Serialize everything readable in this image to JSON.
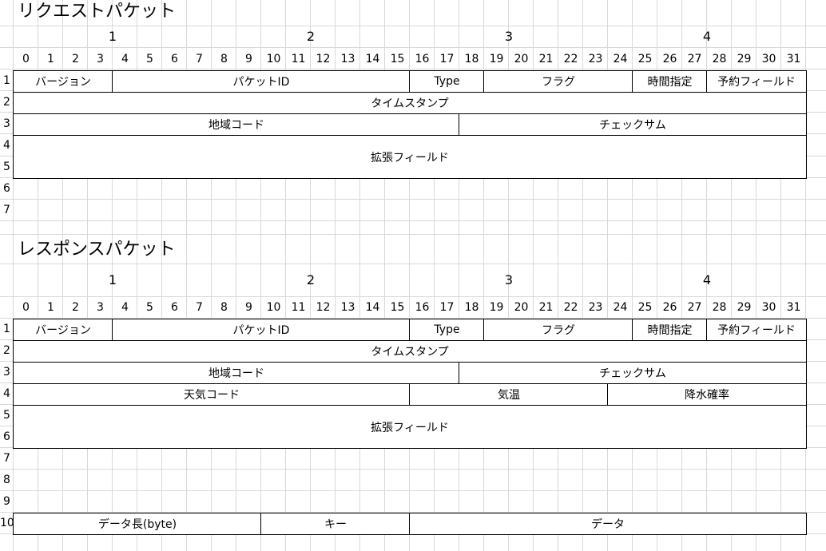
{
  "sheet": {
    "grid_line_color": "#d9d9d9",
    "border_color": "#000000"
  },
  "sections": [
    {
      "id": "request",
      "title": "リクエストパケット",
      "byte_labels": [
        "1",
        "2",
        "3",
        "4"
      ],
      "bit_labels": [
        "0",
        "1",
        "2",
        "3",
        "4",
        "5",
        "6",
        "7",
        "8",
        "9",
        "10",
        "11",
        "12",
        "13",
        "14",
        "15",
        "16",
        "17",
        "18",
        "19",
        "20",
        "21",
        "22",
        "23",
        "24",
        "25",
        "26",
        "27",
        "28",
        "29",
        "30",
        "31"
      ],
      "row_labels": [
        "1",
        "2",
        "3",
        "4",
        "5",
        "6",
        "7"
      ],
      "fields": [
        {
          "label": "バージョン",
          "row": 1,
          "rows": 1,
          "bit_start": 0,
          "bit_end": 3
        },
        {
          "label": "パケットID",
          "row": 1,
          "rows": 1,
          "bit_start": 4,
          "bit_end": 15
        },
        {
          "label": "Type",
          "row": 1,
          "rows": 1,
          "bit_start": 16,
          "bit_end": 18
        },
        {
          "label": "フラグ",
          "row": 1,
          "rows": 1,
          "bit_start": 19,
          "bit_end": 24
        },
        {
          "label": "時間指定",
          "row": 1,
          "rows": 1,
          "bit_start": 25,
          "bit_end": 27
        },
        {
          "label": "予約フィールド",
          "row": 1,
          "rows": 1,
          "bit_start": 28,
          "bit_end": 31
        },
        {
          "label": "タイムスタンプ",
          "row": 2,
          "rows": 1,
          "bit_start": 0,
          "bit_end": 31
        },
        {
          "label": "地域コード",
          "row": 3,
          "rows": 1,
          "bit_start": 0,
          "bit_end": 17
        },
        {
          "label": "チェックサム",
          "row": 3,
          "rows": 1,
          "bit_start": 18,
          "bit_end": 31
        },
        {
          "label": "拡張フィールド",
          "row": 4,
          "rows": 2,
          "bit_start": 0,
          "bit_end": 31
        }
      ]
    },
    {
      "id": "response",
      "title": "レスポンスパケット",
      "byte_labels": [
        "1",
        "2",
        "3",
        "4"
      ],
      "bit_labels": [
        "0",
        "1",
        "2",
        "3",
        "4",
        "5",
        "6",
        "7",
        "8",
        "9",
        "10",
        "11",
        "12",
        "13",
        "14",
        "15",
        "16",
        "17",
        "18",
        "19",
        "20",
        "21",
        "22",
        "23",
        "24",
        "25",
        "26",
        "27",
        "28",
        "29",
        "30",
        "31"
      ],
      "row_labels": [
        "1",
        "2",
        "3",
        "4",
        "5",
        "6",
        "7",
        "8",
        "9",
        "10"
      ],
      "fields": [
        {
          "label": "バージョン",
          "row": 1,
          "rows": 1,
          "bit_start": 0,
          "bit_end": 3
        },
        {
          "label": "パケットID",
          "row": 1,
          "rows": 1,
          "bit_start": 4,
          "bit_end": 15
        },
        {
          "label": "Type",
          "row": 1,
          "rows": 1,
          "bit_start": 16,
          "bit_end": 18
        },
        {
          "label": "フラグ",
          "row": 1,
          "rows": 1,
          "bit_start": 19,
          "bit_end": 24
        },
        {
          "label": "時間指定",
          "row": 1,
          "rows": 1,
          "bit_start": 25,
          "bit_end": 27
        },
        {
          "label": "予約フィールド",
          "row": 1,
          "rows": 1,
          "bit_start": 28,
          "bit_end": 31
        },
        {
          "label": "タイムスタンプ",
          "row": 2,
          "rows": 1,
          "bit_start": 0,
          "bit_end": 31
        },
        {
          "label": "地域コード",
          "row": 3,
          "rows": 1,
          "bit_start": 0,
          "bit_end": 17
        },
        {
          "label": "チェックサム",
          "row": 3,
          "rows": 1,
          "bit_start": 18,
          "bit_end": 31
        },
        {
          "label": "天気コード",
          "row": 4,
          "rows": 1,
          "bit_start": 0,
          "bit_end": 15
        },
        {
          "label": "気温",
          "row": 4,
          "rows": 1,
          "bit_start": 16,
          "bit_end": 23
        },
        {
          "label": "降水確率",
          "row": 4,
          "rows": 1,
          "bit_start": 24,
          "bit_end": 31
        },
        {
          "label": "拡張フィールド",
          "row": 5,
          "rows": 2,
          "bit_start": 0,
          "bit_end": 31
        },
        {
          "label": "データ長(byte)",
          "row": 10,
          "rows": 1,
          "bit_start": 0,
          "bit_end": 9
        },
        {
          "label": "キー",
          "row": 10,
          "rows": 1,
          "bit_start": 10,
          "bit_end": 15
        },
        {
          "label": "データ",
          "row": 10,
          "rows": 1,
          "bit_start": 16,
          "bit_end": 31
        }
      ]
    }
  ]
}
